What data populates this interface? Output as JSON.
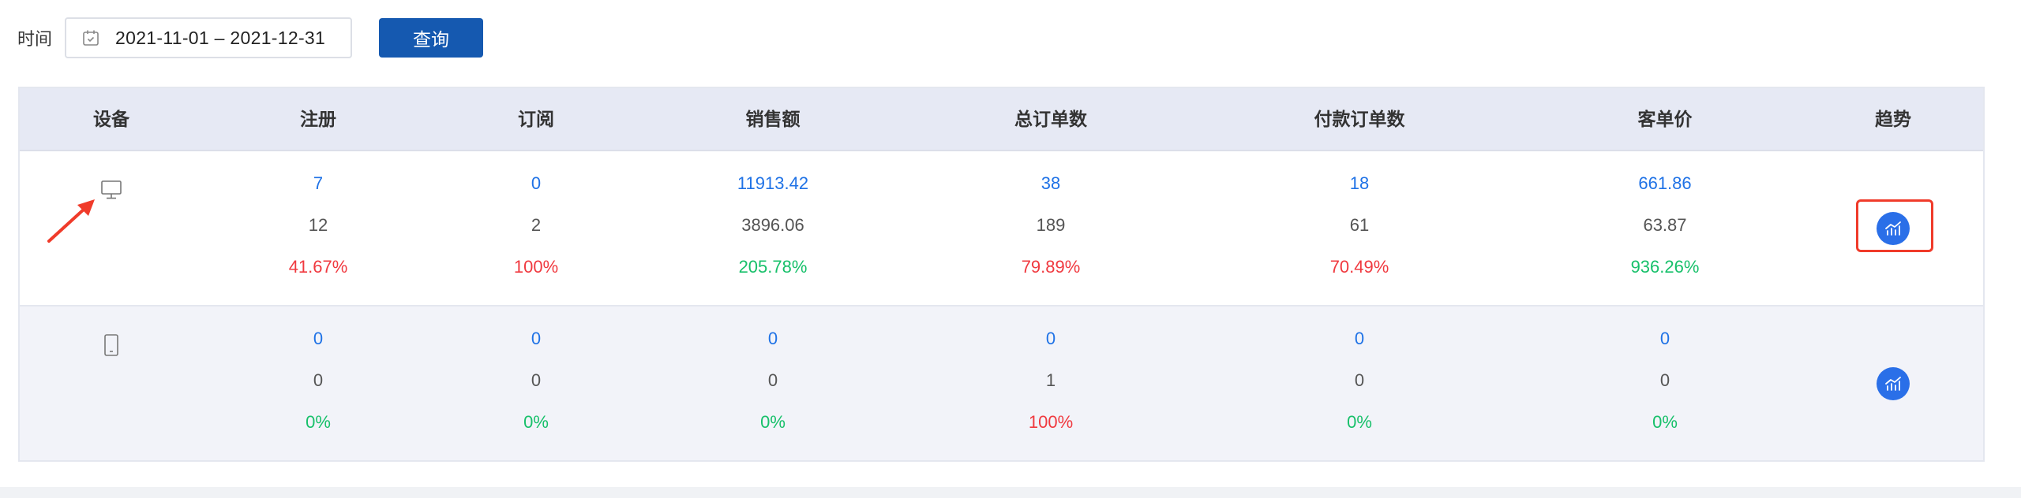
{
  "filter": {
    "time_label": "时间",
    "date_range": "2021-11-01 – 2021-12-31",
    "query_label": "查询"
  },
  "table": {
    "headers": [
      "设备",
      "注册",
      "订阅",
      "销售额",
      "总订单数",
      "付款订单数",
      "客单价",
      "趋势"
    ],
    "rows": [
      {
        "device_icon": "monitor-icon",
        "cells": [
          [
            "7",
            "12",
            "41.67%"
          ],
          [
            "0",
            "2",
            "100%"
          ],
          [
            "11913.42",
            "3896.06",
            "205.78%"
          ],
          [
            "38",
            "189",
            "79.89%"
          ],
          [
            "18",
            "61",
            "70.49%"
          ],
          [
            "661.86",
            "63.87",
            "936.26%"
          ]
        ],
        "trend_icon": "trend-chart-icon"
      },
      {
        "device_icon": "mobile-phone-icon",
        "cells": [
          [
            "0",
            "0",
            "0%"
          ],
          [
            "0",
            "0",
            "0%"
          ],
          [
            "0",
            "0",
            "0%"
          ],
          [
            "0",
            "1",
            "100%"
          ],
          [
            "0",
            "0",
            "0%"
          ],
          [
            "0",
            "0",
            "0%"
          ]
        ],
        "trend_icon": "trend-chart-icon"
      }
    ]
  },
  "colors": {
    "primary_blue": "#1f72e6",
    "button_blue": "#1559b0",
    "increase_red": "#f0393f",
    "increase_green": "#17c06a",
    "header_bg": "#e6e9f4",
    "annotation_red": "#f03b2a"
  }
}
